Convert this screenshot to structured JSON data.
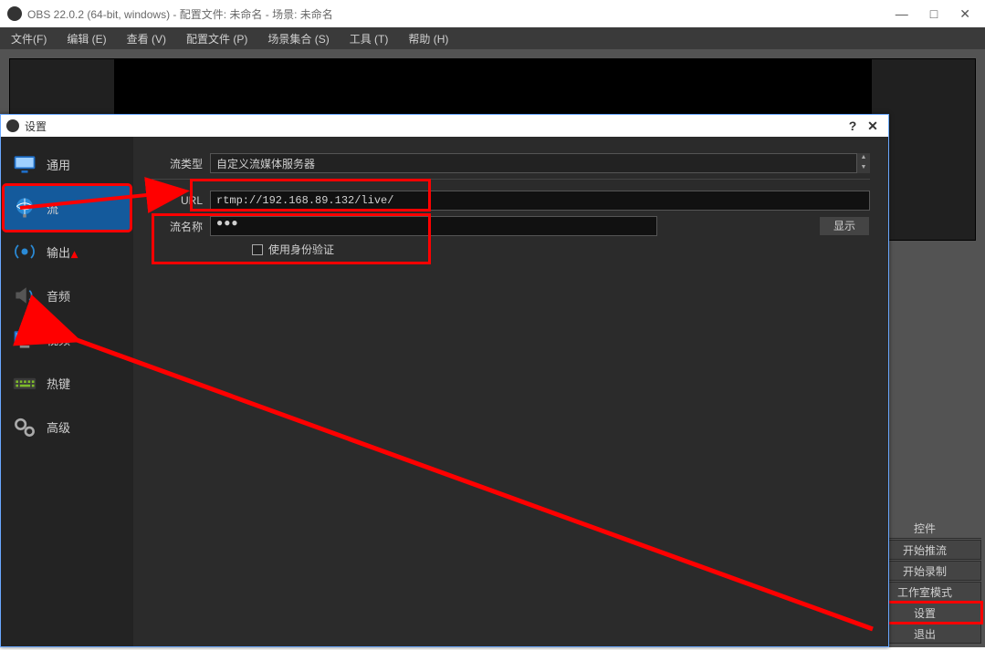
{
  "main": {
    "title": "OBS 22.0.2 (64-bit, windows) - 配置文件: 未命名 - 场景: 未命名",
    "menu": {
      "file": "文件(F)",
      "edit": "编辑 (E)",
      "view": "查看 (V)",
      "profiles": "配置文件 (P)",
      "scenes": "场景集合 (S)",
      "tools": "工具 (T)",
      "help": "帮助 (H)"
    },
    "win": {
      "min": "—",
      "max": "□",
      "close": "✕"
    },
    "controls": {
      "header": "控件",
      "start_stream": "开始推流",
      "start_record": "开始录制",
      "studio_mode": "工作室模式",
      "settings": "设置",
      "exit": "退出"
    }
  },
  "dialog": {
    "title": "设置",
    "help": "?",
    "close": "✕",
    "sidebar": {
      "general": "通用",
      "stream": "流",
      "output": "输出",
      "audio": "音频",
      "video": "视频",
      "hotkeys": "热键",
      "advanced": "高级"
    },
    "form": {
      "stream_type_label": "流类型",
      "stream_type_value": "自定义流媒体服务器",
      "url_label": "URL",
      "url_value": "rtmp://192.168.89.132/live/",
      "key_label": "流名称",
      "key_value": "●●●",
      "show": "显示",
      "auth_label": "使用身份验证"
    }
  }
}
